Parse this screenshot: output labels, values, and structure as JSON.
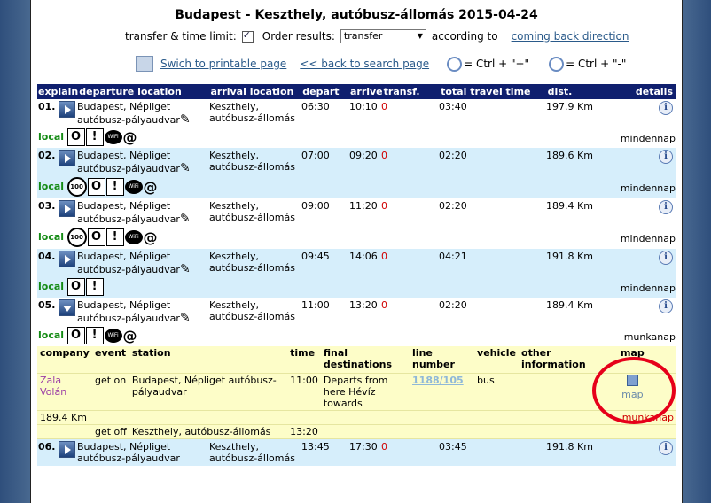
{
  "title": "Budapest - Keszthely, autóbusz-állomás 2015-04-24",
  "options": {
    "transfer_label": "transfer & time limit:",
    "order_label": "Order results:",
    "order_value": "transfer",
    "according": "according to",
    "coming_back": "coming back direction"
  },
  "links": {
    "printable": "Swich to printable page",
    "back": "<< back to search page",
    "zoom_in": "= Ctrl + \"+\"",
    "zoom_out": "= Ctrl + \"-\""
  },
  "headers": [
    "explain",
    "departure location",
    "arrival location",
    "depart",
    "arrive",
    "transf.",
    "total travel time",
    "dist.",
    "details"
  ],
  "trips": [
    {
      "num": "01.",
      "from": "Budapest, Népliget autóbusz-pályaudvar",
      "to": "Keszthely, autóbusz-állomás",
      "dep": "06:30",
      "arr": "10:10",
      "transf": "0",
      "total": "03:40",
      "dist": "197.9 Km",
      "local": "local",
      "days": "mindennap",
      "icons": [
        "box-o",
        "box-excl",
        "wifi",
        "at"
      ]
    },
    {
      "num": "02.",
      "from": "Budapest, Népliget autóbusz-pályaudvar",
      "to": "Keszthely, autóbusz-állomás",
      "dep": "07:00",
      "arr": "09:20",
      "transf": "0",
      "total": "02:20",
      "dist": "189.6 Km",
      "local": "local",
      "days": "mindennap",
      "icons": [
        "c100",
        "box-o",
        "box-excl",
        "wifi",
        "at"
      ]
    },
    {
      "num": "03.",
      "from": "Budapest, Népliget autóbusz-pályaudvar",
      "to": "Keszthely, autóbusz-állomás",
      "dep": "09:00",
      "arr": "11:20",
      "transf": "0",
      "total": "02:20",
      "dist": "189.4 Km",
      "local": "local",
      "days": "mindennap",
      "icons": [
        "c100",
        "box-o",
        "box-excl",
        "wifi",
        "at"
      ]
    },
    {
      "num": "04.",
      "from": "Budapest, Népliget autóbusz-pályaudvar",
      "to": "Keszthely, autóbusz-állomás",
      "dep": "09:45",
      "arr": "14:06",
      "transf": "0",
      "total": "04:21",
      "dist": "191.8 Km",
      "local": "local",
      "days": "mindennap",
      "icons": [
        "box-o",
        "box-excl"
      ]
    },
    {
      "num": "05.",
      "from": "Budapest, Népliget autóbusz-pályaudvar",
      "to": "Keszthely, autóbusz-állomás",
      "dep": "11:00",
      "arr": "13:20",
      "transf": "0",
      "total": "02:20",
      "dist": "189.4 Km",
      "local": "local",
      "days": "munkanap",
      "icons": [
        "box-o",
        "box-excl",
        "wifi",
        "at"
      ]
    }
  ],
  "detail": {
    "headers": {
      "company": "company",
      "event": "event",
      "station": "station",
      "time": "time",
      "final": "final destinations",
      "line": "line number",
      "vehicle": "vehicle",
      "other": "other information",
      "map": "map"
    },
    "company": "Zala Volán",
    "event1": "get on",
    "station1": "Budapest, Népliget autóbusz-pályaudvar",
    "time1": "11:00",
    "final": "Departs from here Hévíz towards",
    "line": "1188/105",
    "vehicle": "bus",
    "map_label": "map",
    "dist": "189.4 Km",
    "days": "munkanap",
    "event2": "get off",
    "station2": "Keszthely, autóbusz-állomás",
    "time2": "13:20"
  },
  "trip6": {
    "num": "06.",
    "from": "Budapest, Népliget autóbusz-pályaudvar",
    "to": "Keszthely, autóbusz-állomás",
    "dep": "13:45",
    "arr": "17:30",
    "transf": "0",
    "total": "03:45",
    "dist": "191.8 Km"
  },
  "glyphs": {
    "box_o": "O",
    "box_excl": "!",
    "c100": "100",
    "wifi": "WiFi",
    "at": "@",
    "info": "i"
  },
  "colors": {
    "header_bg": "#0f1f6e",
    "row_blue": "#d6eefb",
    "detail_bg": "#fdfdc8",
    "red": "#d00000",
    "annotation": "#e6001a"
  }
}
